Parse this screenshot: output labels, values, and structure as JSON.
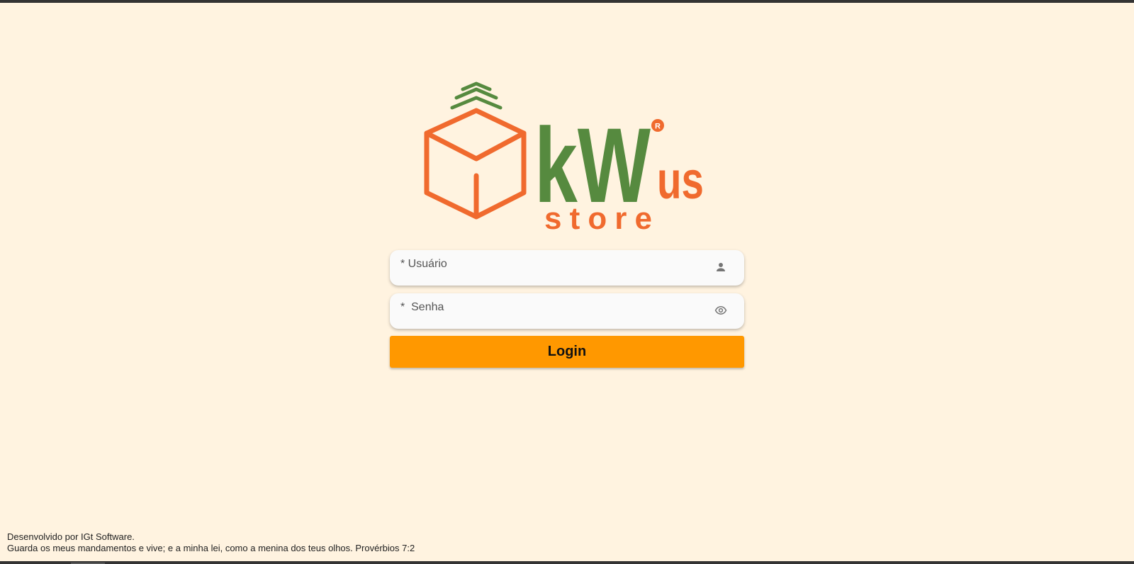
{
  "logo": {
    "brand_main": "kW",
    "brand_suffix": "us",
    "brand_sub": "store",
    "registered_mark": "R",
    "colors": {
      "orange": "#f06a2e",
      "green": "#568a3f"
    }
  },
  "login_form": {
    "username": {
      "label": "* Usuário",
      "value": "",
      "icon": "person-icon"
    },
    "password": {
      "label": "*  Senha",
      "value": "",
      "icon": "eye-icon"
    },
    "submit_label": "Login"
  },
  "footer": {
    "credit": "Desenvolvido por IGt Software.",
    "quote": "Guarda os meus mandamentos e vive; e a minha lei, como a menina dos teus olhos. Provérbios 7:2"
  },
  "colors": {
    "background": "#fff3e0",
    "button": "#ff9800",
    "field_background": "#fafafa",
    "frame": "#333333"
  }
}
